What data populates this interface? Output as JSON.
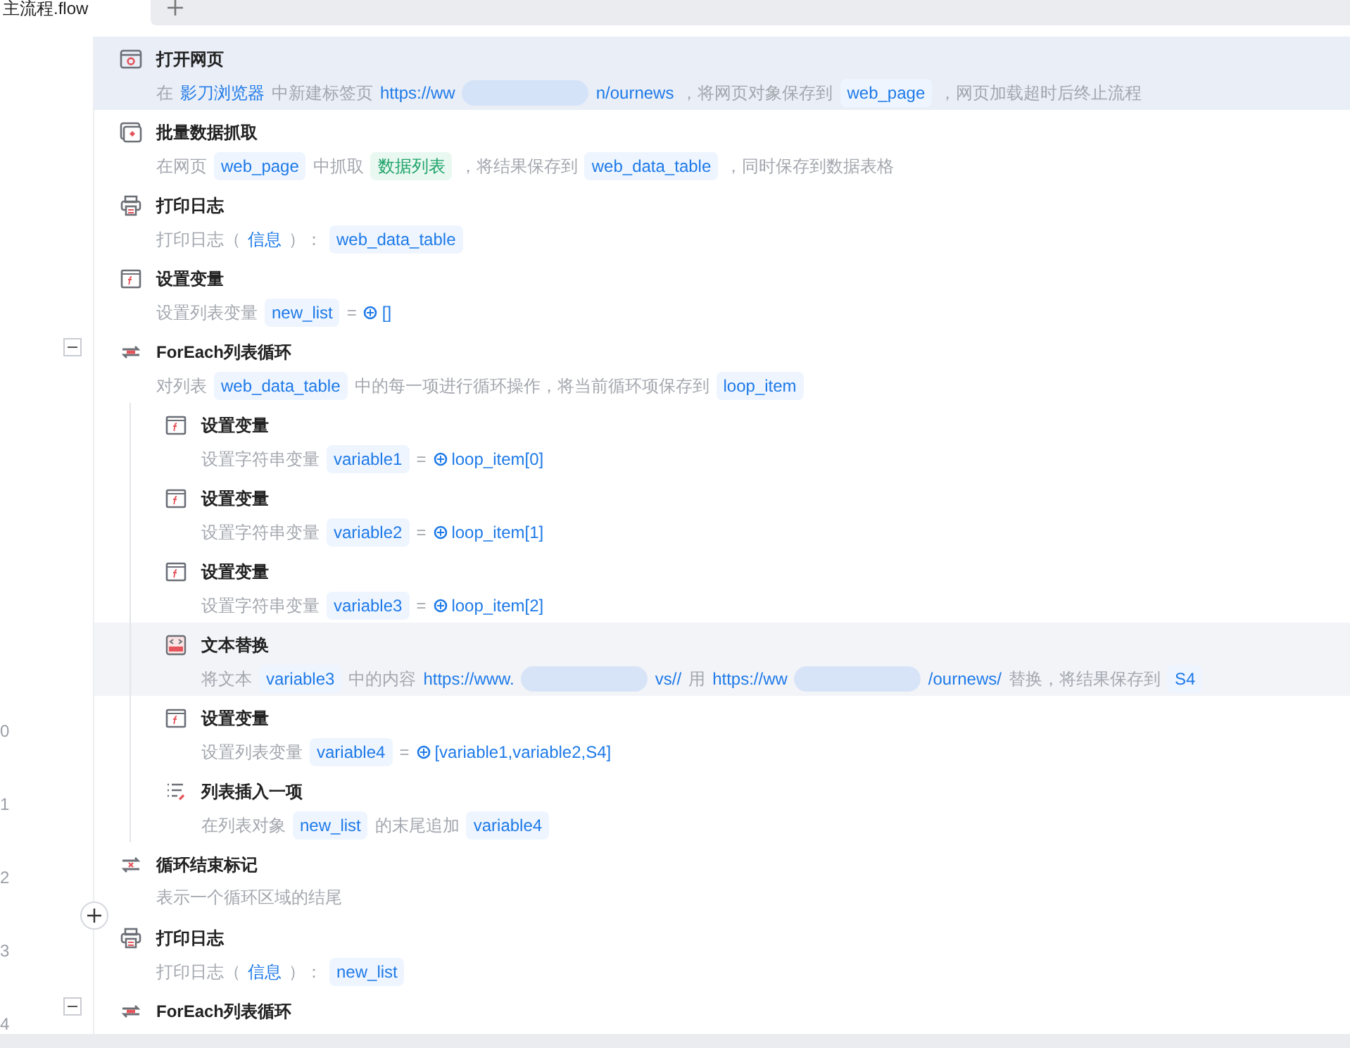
{
  "tabs": [
    {
      "label": "主流程.flow",
      "selected": true
    }
  ],
  "steps": [
    {
      "kind": "browser",
      "title": "打开网页",
      "selected": true,
      "hovered": false,
      "desc": [
        {
          "kind": "text",
          "text": "在"
        },
        {
          "kind": "link",
          "text": "影刀浏览器"
        },
        {
          "kind": "text",
          "text": "中新建标签页"
        },
        {
          "kind": "link",
          "text": "https://ww"
        },
        {
          "kind": "redaction"
        },
        {
          "kind": "link",
          "text": "n/ournews"
        },
        {
          "kind": "text",
          "text": "，将网页对象保存到"
        },
        {
          "kind": "var",
          "text": "web_page"
        },
        {
          "kind": "text",
          "text": "，网页加载超时后终止流程"
        }
      ]
    },
    {
      "kind": "scrape",
      "title": "批量数据抓取",
      "selected": false,
      "hovered": false,
      "desc": [
        {
          "kind": "text",
          "text": "在网页"
        },
        {
          "kind": "var",
          "text": "web_page"
        },
        {
          "kind": "text",
          "text": "中抓取"
        },
        {
          "kind": "tag",
          "text": "数据列表"
        },
        {
          "kind": "text",
          "text": "，将结果保存到"
        },
        {
          "kind": "var",
          "text": "web_data_table"
        },
        {
          "kind": "text",
          "text": "，同时保存到数据表格"
        }
      ]
    },
    {
      "kind": "print",
      "title": "打印日志",
      "selected": false,
      "hovered": false,
      "desc": [
        {
          "kind": "text",
          "text": "打印日志（"
        },
        {
          "kind": "link",
          "text": "信息"
        },
        {
          "kind": "text",
          "text": "）："
        },
        {
          "kind": "var",
          "text": "web_data_table"
        }
      ]
    },
    {
      "kind": "variable",
      "title": "设置变量",
      "selected": false,
      "hovered": false,
      "desc": [
        {
          "kind": "text",
          "text": "设置列表变量"
        },
        {
          "kind": "var",
          "text": "new_list"
        },
        {
          "kind": "text",
          "text": "="
        },
        {
          "kind": "expr",
          "text": "[]"
        }
      ]
    },
    {
      "kind": "loop",
      "title": "ForEach列表循环",
      "selected": false,
      "hovered": false,
      "expanded": true,
      "desc": [
        {
          "kind": "text",
          "text": "对列表"
        },
        {
          "kind": "var",
          "text": "web_data_table"
        },
        {
          "kind": "text",
          "text": "中的每一项进行循环操作，将当前循环项保存到"
        },
        {
          "kind": "var",
          "text": "loop_item"
        }
      ],
      "children": [
        {
          "kind": "variable",
          "title": "设置变量",
          "selected": false,
          "hovered": false,
          "desc": [
            {
              "kind": "text",
              "text": "设置字符串变量"
            },
            {
              "kind": "var",
              "text": "variable1"
            },
            {
              "kind": "text",
              "text": "="
            },
            {
              "kind": "expr",
              "text": "loop_item[0]"
            }
          ]
        },
        {
          "kind": "variable",
          "title": "设置变量",
          "selected": false,
          "hovered": false,
          "desc": [
            {
              "kind": "text",
              "text": "设置字符串变量"
            },
            {
              "kind": "var",
              "text": "variable2"
            },
            {
              "kind": "text",
              "text": "="
            },
            {
              "kind": "expr",
              "text": "loop_item[1]"
            }
          ]
        },
        {
          "kind": "variable",
          "title": "设置变量",
          "selected": false,
          "hovered": false,
          "desc": [
            {
              "kind": "text",
              "text": "设置字符串变量"
            },
            {
              "kind": "var",
              "text": "variable3"
            },
            {
              "kind": "text",
              "text": "="
            },
            {
              "kind": "expr",
              "text": "loop_item[2]"
            }
          ]
        },
        {
          "kind": "replace",
          "title": "文本替换",
          "selected": false,
          "hovered": true,
          "desc": [
            {
              "kind": "text",
              "text": "将文本"
            },
            {
              "kind": "var",
              "text": "variable3"
            },
            {
              "kind": "text",
              "text": "中的内容"
            },
            {
              "kind": "link",
              "text": "https://www."
            },
            {
              "kind": "redaction"
            },
            {
              "kind": "link",
              "text": "vs//"
            },
            {
              "kind": "text",
              "text": "用"
            },
            {
              "kind": "link",
              "text": "https://ww"
            },
            {
              "kind": "redaction"
            },
            {
              "kind": "link",
              "text": "/ournews/"
            },
            {
              "kind": "text",
              "text": "替换，将结果保存到"
            },
            {
              "kind": "var",
              "text": "S4"
            }
          ]
        },
        {
          "kind": "variable",
          "title": "设置变量",
          "line_number": "0",
          "selected": false,
          "hovered": false,
          "desc": [
            {
              "kind": "text",
              "text": "设置列表变量"
            },
            {
              "kind": "var",
              "text": "variable4"
            },
            {
              "kind": "text",
              "text": "="
            },
            {
              "kind": "expr",
              "text": "[variable1,variable2,S4]"
            }
          ]
        },
        {
          "kind": "list-insert",
          "title": "列表插入一项",
          "line_number": "1",
          "selected": false,
          "hovered": false,
          "desc": [
            {
              "kind": "text",
              "text": "在列表对象"
            },
            {
              "kind": "var",
              "text": "new_list"
            },
            {
              "kind": "text",
              "text": "的末尾追加"
            },
            {
              "kind": "var",
              "text": "variable4"
            }
          ]
        }
      ]
    },
    {
      "kind": "loop-end",
      "title": "循环结束标记",
      "line_number": "2",
      "selected": false,
      "hovered": false,
      "insert_after": true,
      "desc": [
        {
          "kind": "text",
          "text": "表示一个循环区域的结尾"
        }
      ]
    },
    {
      "kind": "print",
      "title": "打印日志",
      "line_number": "3",
      "selected": false,
      "hovered": false,
      "desc": [
        {
          "kind": "text",
          "text": "打印日志（"
        },
        {
          "kind": "link",
          "text": "信息"
        },
        {
          "kind": "text",
          "text": "）："
        },
        {
          "kind": "var",
          "text": "new_list"
        }
      ]
    },
    {
      "kind": "loop",
      "title": "ForEach列表循环",
      "line_number": "4",
      "selected": false,
      "hovered": false,
      "expanded": true
    }
  ]
}
